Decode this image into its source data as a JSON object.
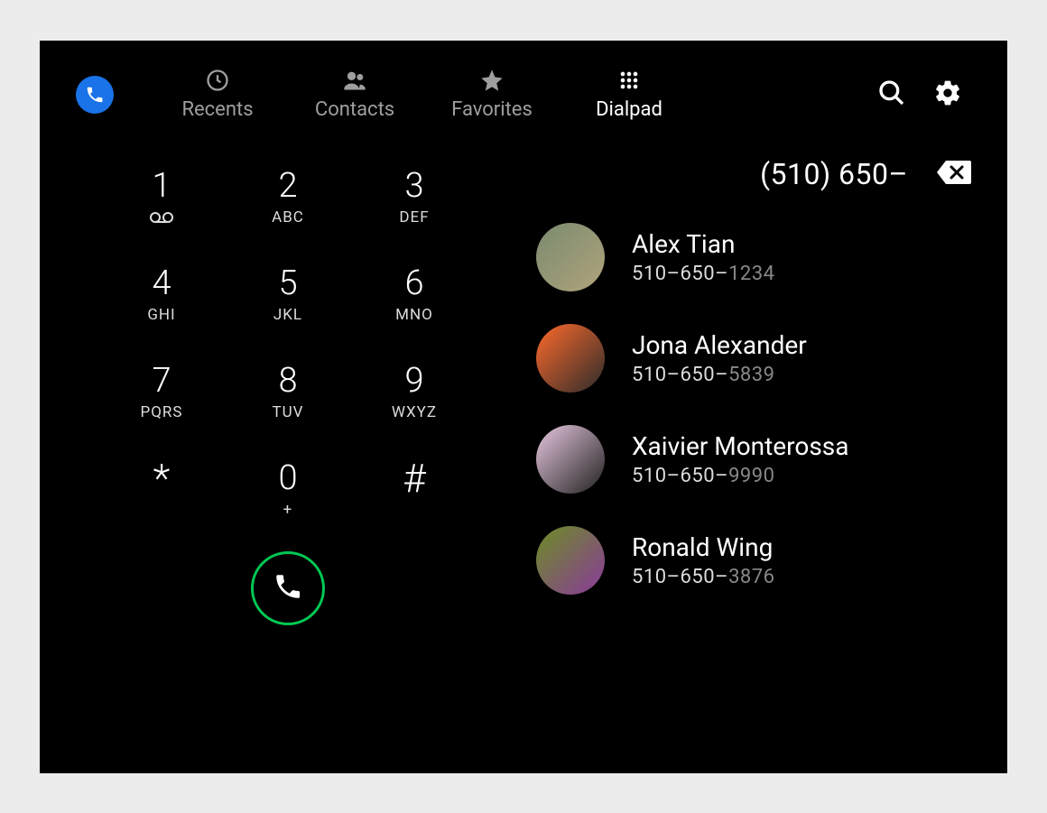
{
  "tabs": [
    {
      "id": "recents",
      "label": "Recents",
      "active": false
    },
    {
      "id": "contacts",
      "label": "Contacts",
      "active": false
    },
    {
      "id": "favorites",
      "label": "Favorites",
      "active": false
    },
    {
      "id": "dialpad",
      "label": "Dialpad",
      "active": true
    }
  ],
  "dialpad": {
    "keys": [
      {
        "digit": "1",
        "sub_icon": "voicemail"
      },
      {
        "digit": "2",
        "sub": "ABC"
      },
      {
        "digit": "3",
        "sub": "DEF"
      },
      {
        "digit": "4",
        "sub": "GHI"
      },
      {
        "digit": "5",
        "sub": "JKL"
      },
      {
        "digit": "6",
        "sub": "MNO"
      },
      {
        "digit": "7",
        "sub": "PQRS"
      },
      {
        "digit": "8",
        "sub": "TUV"
      },
      {
        "digit": "9",
        "sub": "WXYZ"
      },
      {
        "digit": "*",
        "sub": ""
      },
      {
        "digit": "0",
        "sub": "+"
      },
      {
        "digit": "#",
        "sub": ""
      }
    ]
  },
  "dialed": "(510) 650–",
  "match_prefix": "510–650–",
  "suggestions": [
    {
      "name": "Alex Tian",
      "rest": "1234",
      "avatar_bg": "linear-gradient(135deg,#7a8a6f,#b0a47c)"
    },
    {
      "name": "Jona Alexander",
      "rest": "5839",
      "avatar_bg": "linear-gradient(135deg,#ff6a2b,#2b2b2b)"
    },
    {
      "name": "Xaivier Monterossa",
      "rest": "9990",
      "avatar_bg": "linear-gradient(135deg,#e8c8e0,#202020)"
    },
    {
      "name": "Ronald Wing",
      "rest": "3876",
      "avatar_bg": "linear-gradient(135deg,#6b8e23,#8b3a9b)"
    }
  ]
}
